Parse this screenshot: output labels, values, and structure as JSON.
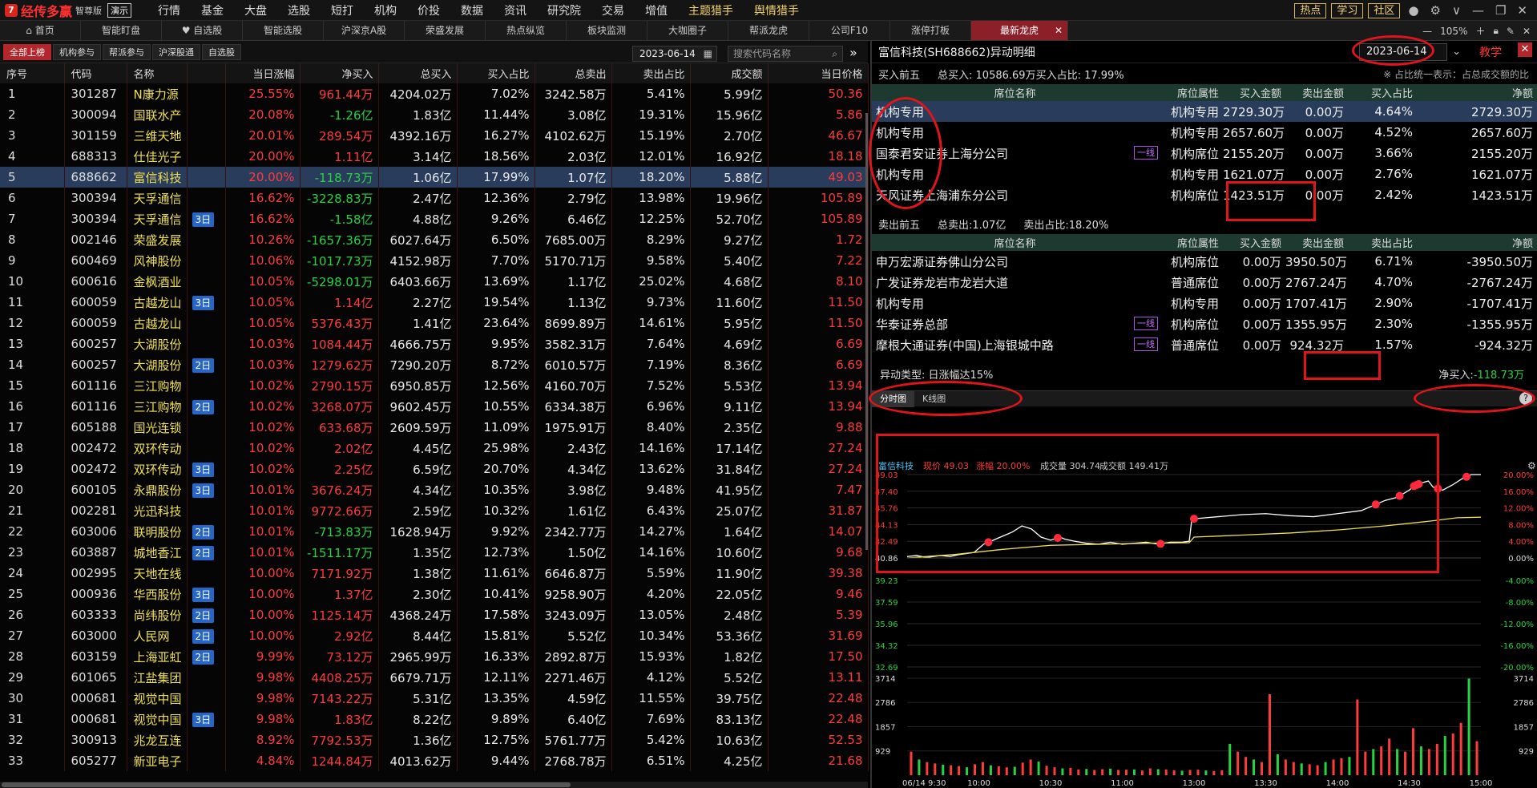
{
  "app": {
    "name": "经传多赢",
    "edition": "智尊版",
    "demo": "演示",
    "logo_char": "7"
  },
  "menu": [
    {
      "label": "行情",
      "dot": true
    },
    {
      "label": "基金"
    },
    {
      "label": "大盘"
    },
    {
      "label": "选股"
    },
    {
      "label": "短打"
    },
    {
      "label": "机构"
    },
    {
      "label": "价投"
    },
    {
      "label": "数据"
    },
    {
      "label": "资讯"
    },
    {
      "label": "研究院"
    },
    {
      "label": "交易"
    },
    {
      "label": "增值",
      "dot": true
    },
    {
      "label": "主题猎手",
      "dot": true,
      "hl": true
    },
    {
      "label": "舆情猎手",
      "dot": true,
      "hl": true
    }
  ],
  "topright": {
    "hot": "热点",
    "learn": "学习",
    "community": "社区"
  },
  "navtabs": [
    "首页",
    "智能盯盘",
    "自选股",
    "智能选股",
    "沪深京A股",
    "荣盛发展",
    "热点纵览",
    "板块监测",
    "大咖圈子",
    "帮派龙虎",
    "公司F10",
    "涨停打板",
    "最新龙虎"
  ],
  "navicons": {
    "首页": "⌂",
    "自选股": "♥"
  },
  "zoom": "105%",
  "subtabs": [
    "全部上榜",
    "机构参与",
    "帮派参与",
    "沪深股通",
    "自选股"
  ],
  "left_date": "2023-06-14",
  "search_placeholder": "搜索代码名称",
  "table_headers": [
    "序号",
    "代码",
    "名称",
    "",
    "当日涨幅",
    "净买入",
    "总买入",
    "买入占比",
    "总卖出",
    "卖出占比",
    "成交额",
    "当日价格"
  ],
  "rows": [
    [
      "1",
      "301287",
      "N康力源",
      "",
      "25.55%",
      "961.44万",
      "4204.02万",
      "7.02%",
      "3242.58万",
      "5.41%",
      "5.99亿",
      "50.36"
    ],
    [
      "2",
      "300094",
      "国联水产",
      "",
      "20.08%",
      "-1.26亿",
      "1.83亿",
      "11.44%",
      "3.08亿",
      "19.31%",
      "15.96亿",
      "5.86"
    ],
    [
      "3",
      "301159",
      "三维天地",
      "",
      "20.01%",
      "289.54万",
      "4392.16万",
      "16.27%",
      "4102.62万",
      "15.19%",
      "2.70亿",
      "46.67"
    ],
    [
      "4",
      "688313",
      "仕佳光子",
      "",
      "20.00%",
      "1.11亿",
      "3.14亿",
      "18.56%",
      "2.03亿",
      "12.01%",
      "16.92亿",
      "18.18"
    ],
    [
      "5",
      "688662",
      "富信科技",
      "",
      "20.00%",
      "-118.73万",
      "1.06亿",
      "17.99%",
      "1.07亿",
      "18.20%",
      "5.88亿",
      "49.03"
    ],
    [
      "6",
      "300394",
      "天孚通信",
      "",
      "16.62%",
      "-3228.83万",
      "2.47亿",
      "12.36%",
      "2.79亿",
      "13.98%",
      "19.96亿",
      "105.89"
    ],
    [
      "7",
      "300394",
      "天孚通信",
      "3日",
      "16.62%",
      "-1.58亿",
      "4.88亿",
      "9.26%",
      "6.46亿",
      "12.25%",
      "52.70亿",
      "105.89"
    ],
    [
      "8",
      "002146",
      "荣盛发展",
      "",
      "10.26%",
      "-1657.36万",
      "6027.64万",
      "6.50%",
      "7685.00万",
      "8.29%",
      "9.27亿",
      "1.72"
    ],
    [
      "9",
      "600469",
      "风神股份",
      "",
      "10.06%",
      "-1017.73万",
      "4152.98万",
      "7.70%",
      "5170.71万",
      "9.58%",
      "5.40亿",
      "7.22"
    ],
    [
      "10",
      "600616",
      "金枫酒业",
      "",
      "10.05%",
      "-5298.01万",
      "6403.66万",
      "13.69%",
      "1.17亿",
      "25.02%",
      "4.68亿",
      "8.10"
    ],
    [
      "11",
      "600059",
      "古越龙山",
      "3日",
      "10.05%",
      "1.14亿",
      "2.27亿",
      "19.54%",
      "1.13亿",
      "9.73%",
      "11.60亿",
      "11.50"
    ],
    [
      "12",
      "600059",
      "古越龙山",
      "",
      "10.05%",
      "5376.43万",
      "1.41亿",
      "23.64%",
      "8699.89万",
      "14.61%",
      "5.95亿",
      "11.50"
    ],
    [
      "13",
      "600257",
      "大湖股份",
      "",
      "10.03%",
      "1084.44万",
      "4666.75万",
      "9.95%",
      "3582.31万",
      "7.64%",
      "4.69亿",
      "6.69"
    ],
    [
      "14",
      "600257",
      "大湖股份",
      "2日",
      "10.03%",
      "1279.62万",
      "7290.20万",
      "8.72%",
      "6010.57万",
      "7.19%",
      "8.36亿",
      "6.69"
    ],
    [
      "15",
      "601116",
      "三江购物",
      "",
      "10.02%",
      "2790.15万",
      "6950.85万",
      "12.56%",
      "4160.70万",
      "7.52%",
      "5.53亿",
      "13.94"
    ],
    [
      "16",
      "601116",
      "三江购物",
      "2日",
      "10.02%",
      "3268.07万",
      "9602.45万",
      "10.55%",
      "6334.38万",
      "6.96%",
      "9.11亿",
      "13.94"
    ],
    [
      "17",
      "605188",
      "国光连锁",
      "",
      "10.02%",
      "633.68万",
      "2609.59万",
      "11.09%",
      "1975.91万",
      "8.40%",
      "2.35亿",
      "9.88"
    ],
    [
      "18",
      "002472",
      "双环传动",
      "",
      "10.02%",
      "2.02亿",
      "4.45亿",
      "25.98%",
      "2.43亿",
      "14.16%",
      "17.14亿",
      "27.24"
    ],
    [
      "19",
      "002472",
      "双环传动",
      "3日",
      "10.02%",
      "2.25亿",
      "6.59亿",
      "20.70%",
      "4.34亿",
      "13.62%",
      "31.84亿",
      "27.24"
    ],
    [
      "20",
      "600105",
      "永鼎股份",
      "3日",
      "10.01%",
      "3676.24万",
      "4.34亿",
      "10.35%",
      "3.98亿",
      "9.48%",
      "41.95亿",
      "7.47"
    ],
    [
      "21",
      "002281",
      "光迅科技",
      "",
      "10.01%",
      "9772.66万",
      "2.59亿",
      "10.32%",
      "1.61亿",
      "6.43%",
      "25.07亿",
      "31.87"
    ],
    [
      "22",
      "603006",
      "联明股份",
      "2日",
      "10.01%",
      "-713.83万",
      "1628.94万",
      "9.92%",
      "2342.77万",
      "14.27%",
      "1.64亿",
      "14.07"
    ],
    [
      "23",
      "603887",
      "城地香江",
      "2日",
      "10.01%",
      "-1511.17万",
      "1.35亿",
      "12.73%",
      "1.50亿",
      "14.16%",
      "10.60亿",
      "9.68"
    ],
    [
      "24",
      "002995",
      "天地在线",
      "",
      "10.00%",
      "7171.92万",
      "1.38亿",
      "11.61%",
      "6646.87万",
      "5.59%",
      "11.90亿",
      "39.38"
    ],
    [
      "25",
      "000936",
      "华西股份",
      "3日",
      "10.00%",
      "1.37亿",
      "2.30亿",
      "10.41%",
      "9258.90万",
      "4.20%",
      "22.05亿",
      "9.46"
    ],
    [
      "26",
      "603333",
      "尚纬股份",
      "2日",
      "10.00%",
      "1125.14万",
      "4368.24万",
      "17.58%",
      "3243.09万",
      "13.05%",
      "2.48亿",
      "5.39"
    ],
    [
      "27",
      "603000",
      "人民网",
      "2日",
      "10.00%",
      "2.92亿",
      "8.44亿",
      "15.81%",
      "5.52亿",
      "10.34%",
      "53.36亿",
      "31.69"
    ],
    [
      "28",
      "603159",
      "上海亚虹",
      "2日",
      "9.99%",
      "73.12万",
      "2965.99万",
      "16.33%",
      "2892.87万",
      "15.93%",
      "1.82亿",
      "17.50"
    ],
    [
      "29",
      "601065",
      "江盐集团",
      "",
      "9.98%",
      "4408.25万",
      "6679.71万",
      "12.11%",
      "2271.46万",
      "4.12%",
      "5.52亿",
      "13.11"
    ],
    [
      "30",
      "000681",
      "视觉中国",
      "",
      "9.98%",
      "7143.22万",
      "5.31亿",
      "13.35%",
      "4.59亿",
      "11.55%",
      "39.75亿",
      "22.48"
    ],
    [
      "31",
      "000681",
      "视觉中国",
      "3日",
      "9.98%",
      "1.83亿",
      "8.22亿",
      "9.89%",
      "6.40亿",
      "7.69%",
      "83.13亿",
      "22.48"
    ],
    [
      "32",
      "300913",
      "兆龙互连",
      "",
      "8.92%",
      "7792.53万",
      "1.36亿",
      "12.75%",
      "5761.77万",
      "5.42%",
      "10.63亿",
      "52.53"
    ],
    [
      "33",
      "605277",
      "新亚电子",
      "",
      "4.84%",
      "1244.84万",
      "4013.62万",
      "9.44%",
      "2768.78万",
      "6.51%",
      "4.25亿",
      "21.68"
    ]
  ],
  "detail": {
    "title": "富信科技(SH688662)异动明细",
    "date": "2023-06-14",
    "teach": "教学",
    "buy_section": {
      "label": "买入前五",
      "total": "总买入: 10586.69万",
      "ratio": "买入占比: 17.99%",
      "note": "※ 占比统一表示：占总成交额的比"
    },
    "headers": [
      "席位名称",
      "席位属性",
      "买入金额",
      "卖出金额",
      "买入占比",
      "净额"
    ],
    "sell_headers": [
      "席位名称",
      "席位属性",
      "买入金额",
      "卖出金额",
      "卖出占比",
      "净额"
    ],
    "buy_rows": [
      {
        "seat": "机构专用",
        "yx": "",
        "attr": "机构专用",
        "buy": "2729.30万",
        "sell": "0.00万",
        "ratio": "4.64%",
        "net": "2729.30万"
      },
      {
        "seat": "机构专用",
        "yx": "",
        "attr": "机构专用",
        "buy": "2657.60万",
        "sell": "0.00万",
        "ratio": "4.52%",
        "net": "2657.60万"
      },
      {
        "seat": "国泰君安证券上海分公司",
        "yx": "一线",
        "attr": "机构席位",
        "buy": "2155.20万",
        "sell": "0.00万",
        "ratio": "3.66%",
        "net": "2155.20万"
      },
      {
        "seat": "机构专用",
        "yx": "",
        "attr": "机构专用",
        "buy": "1621.07万",
        "sell": "0.00万",
        "ratio": "2.76%",
        "net": "1621.07万"
      },
      {
        "seat": "天风证券上海浦东分公司",
        "yx": "",
        "attr": "机构席位",
        "buy": "1423.51万",
        "sell": "0.00万",
        "ratio": "2.42%",
        "net": "1423.51万"
      }
    ],
    "sell_section": {
      "label": "卖出前五",
      "total": "总卖出:1.07亿",
      "ratio": "卖出占比:18.20%"
    },
    "sell_rows": [
      {
        "seat": "申万宏源证券佛山分公司",
        "yx": "",
        "attr": "机构席位",
        "buy": "0.00万",
        "sell": "3950.50万",
        "ratio": "6.71%",
        "net": "-3950.50万"
      },
      {
        "seat": "广发证券龙岩市龙岩大道",
        "yx": "",
        "attr": "普通席位",
        "buy": "0.00万",
        "sell": "2767.24万",
        "ratio": "4.70%",
        "net": "-2767.24万"
      },
      {
        "seat": "机构专用",
        "yx": "",
        "attr": "机构专用",
        "buy": "0.00万",
        "sell": "1707.41万",
        "ratio": "2.90%",
        "net": "-1707.41万"
      },
      {
        "seat": "华泰证券总部",
        "yx": "一线",
        "attr": "机构席位",
        "buy": "0.00万",
        "sell": "1355.95万",
        "ratio": "2.30%",
        "net": "-1355.95万"
      },
      {
        "seat": "摩根大通证券(中国)上海银城中路",
        "yx": "一线",
        "attr": "普通席位",
        "buy": "0.00万",
        "sell": "924.32万",
        "ratio": "1.57%",
        "net": "-924.32万"
      }
    ],
    "abnormal_type": "异动类型: 日涨幅达15%",
    "net_buy_label": "净买入:",
    "net_buy_value": "-118.73万",
    "chart_tabs": [
      "分时图",
      "K线图"
    ]
  },
  "chart_data": {
    "type": "line",
    "stock_label": "富信科技",
    "price_label": "现价 49.03",
    "change_label": "涨幅 20.00%",
    "volume_label": "成交量 304.74",
    "amount_label": "成交额 149.41万",
    "ylim": [
      40.86,
      49.03
    ],
    "price_ticks": [
      "49.03",
      "47.40",
      "45.76",
      "44.13",
      "42.49",
      "40.86",
      "39.23",
      "37.59",
      "35.96",
      "34.32",
      "32.69"
    ],
    "pct_ticks": [
      "20.00%",
      "16.00%",
      "12.00%",
      "8.00%",
      "4.00%",
      "0.00%",
      "-4.00%",
      "-8.00%",
      "-12.00%",
      "-16.00%",
      "-20.00%"
    ],
    "vol_ticks": [
      "3714",
      "2786",
      "1857",
      "929"
    ],
    "time_ticks": [
      "06/14 9:30",
      "10:00",
      "10:30",
      "11:00",
      "13:00",
      "13:30",
      "14:00",
      "14:30",
      "15:00"
    ],
    "series": [
      {
        "x": [
          0,
          4,
          8,
          14,
          18,
          22,
          28,
          32,
          36,
          40,
          44,
          48,
          52,
          56,
          60,
          64,
          66,
          70,
          75,
          80,
          85,
          90,
          95,
          100,
          105,
          110,
          115,
          118,
          119,
          120,
          125,
          130,
          140,
          150,
          160,
          170,
          180,
          190,
          200,
          205,
          210,
          212,
          215,
          218,
          220,
          224,
          228,
          232,
          236,
          240
        ],
        "y": [
          41.0,
          41.1,
          40.9,
          41.1,
          41.0,
          41.2,
          41.4,
          42.2,
          42.6,
          43.0,
          43.4,
          44.0,
          43.7,
          42.9,
          42.6,
          42.9,
          42.7,
          42.5,
          42.3,
          42.2,
          42.4,
          42.2,
          42.3,
          42.4,
          42.2,
          42.4,
          42.4,
          42.5,
          44.5,
          44.7,
          44.8,
          44.9,
          45.1,
          45.2,
          45.0,
          44.9,
          45.2,
          45.5,
          46.5,
          46.8,
          47.5,
          47.9,
          48.2,
          48.4,
          47.8,
          47.5,
          48.0,
          48.6,
          49.03,
          49.03
        ]
      },
      {
        "x": [
          0,
          20,
          40,
          60,
          80,
          100,
          118,
          120,
          140,
          160,
          180,
          200,
          220,
          230,
          240
        ],
        "y": [
          40.86,
          41.2,
          41.7,
          42.1,
          42.2,
          42.3,
          42.35,
          42.9,
          43.1,
          43.3,
          43.6,
          44.0,
          44.5,
          44.8,
          44.85
        ]
      }
    ],
    "markers_x": [
      34,
      63,
      106,
      120,
      196,
      206,
      212,
      213,
      214,
      222,
      234
    ],
    "volumes": [
      900,
      600,
      500,
      450,
      400,
      380,
      350,
      300,
      420,
      500,
      380,
      340,
      300,
      320,
      480,
      600,
      520,
      360,
      300,
      260,
      280,
      220,
      240,
      200,
      230,
      250,
      200,
      210,
      220,
      180,
      260,
      230,
      220,
      190,
      170,
      200,
      210,
      180,
      160,
      190,
      1200,
      900,
      700,
      600,
      500,
      3100,
      800,
      600,
      500,
      450,
      420,
      380,
      500,
      600,
      650,
      700,
      2900,
      900,
      1000,
      1100,
      1400,
      1000,
      900,
      1800,
      1100,
      1000,
      1200,
      1500,
      1600,
      2000,
      3700,
      1300
    ]
  }
}
